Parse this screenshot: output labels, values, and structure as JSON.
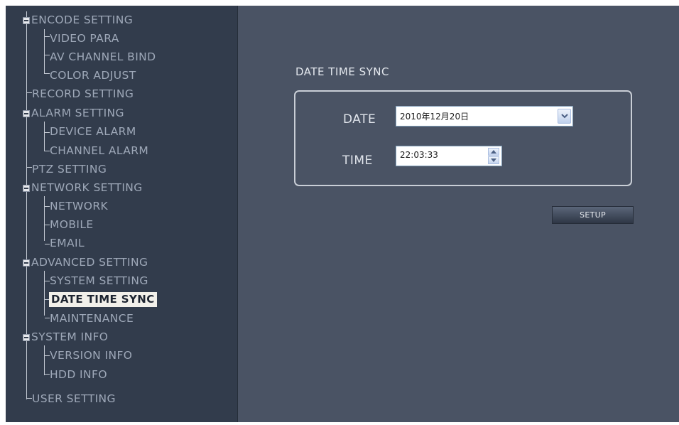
{
  "sidebar": {
    "groups": [
      {
        "label": "ENCODE SETTING",
        "items": [
          "VIDEO PARA",
          "AV CHANNEL BIND",
          "COLOR ADJUST"
        ]
      },
      {
        "label": "RECORD SETTING",
        "items": []
      },
      {
        "label": "ALARM SETTING",
        "items": [
          "DEVICE ALARM",
          "CHANNEL ALARM"
        ]
      },
      {
        "label": "PTZ SETTING",
        "items": []
      },
      {
        "label": "NETWORK SETTING",
        "items": [
          "NETWORK",
          "MOBILE",
          "EMAIL"
        ]
      },
      {
        "label": "ADVANCED SETTING",
        "items": [
          "SYSTEM SETTING",
          "DATE TIME SYNC",
          "MAINTENANCE"
        ]
      },
      {
        "label": "SYSTEM INFO",
        "items": [
          "VERSION INFO",
          "HDD INFO"
        ]
      },
      {
        "label": "USER SETTING",
        "items": []
      }
    ],
    "selected": "DATE TIME SYNC"
  },
  "main": {
    "section_title": "DATE TIME SYNC",
    "date_label": "DATE",
    "date_value": "2010年12月20日",
    "time_label": "TIME",
    "time_value": "22:03:33",
    "setup_label": "SETUP"
  },
  "colors": {
    "sidebar_bg": "#323c4c",
    "main_bg": "#4a5364",
    "tree_text": "#9ea8b8",
    "selected_bg": "#f2f0ea"
  }
}
